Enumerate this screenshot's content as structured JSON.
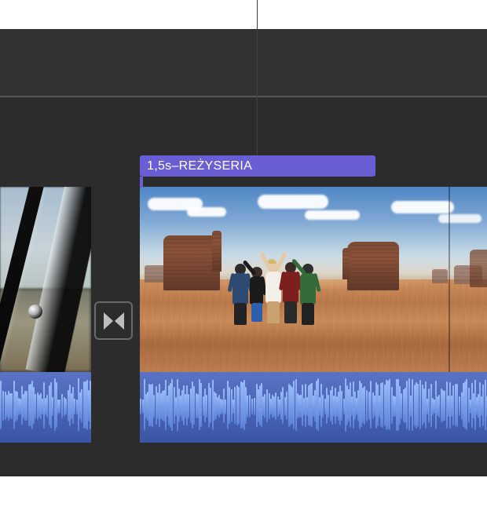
{
  "title_overlay": {
    "duration": "1,5s",
    "separator": " – ",
    "name": "REŻYSERIA"
  },
  "transition": {
    "type": "cross-dissolve"
  }
}
